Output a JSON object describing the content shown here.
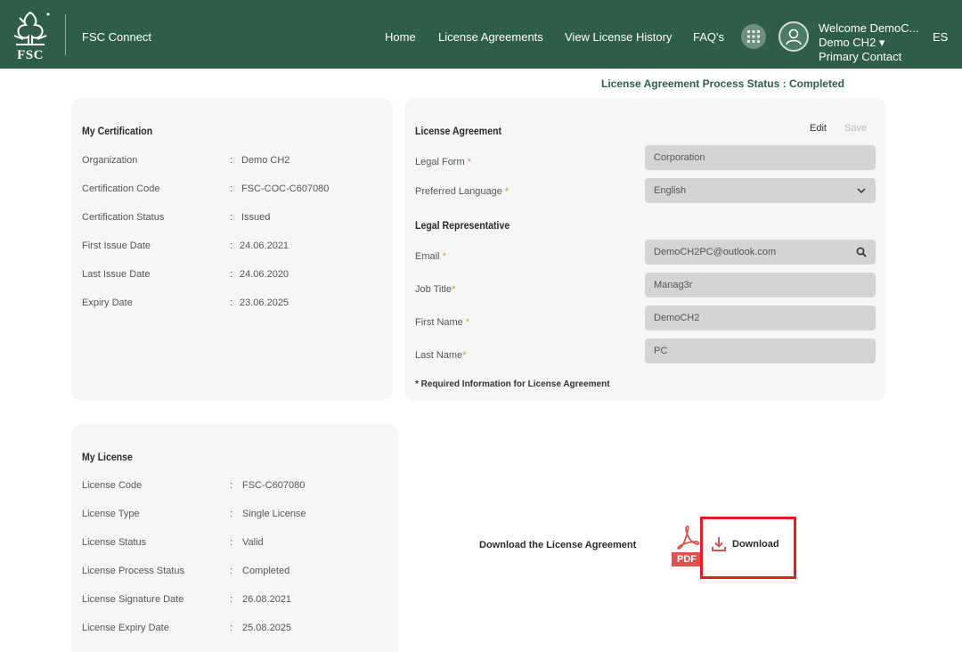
{
  "header": {
    "logo_text": "FSC",
    "app_name": "FSC Connect",
    "nav": [
      "Home",
      "License Agreements",
      "View License History",
      "FAQ's"
    ],
    "welcome_line1": "Welcome DemoC...",
    "welcome_line2": "Demo CH2 ▾",
    "welcome_line3": "Primary Contact",
    "language": "ES",
    "brand_color": "#2e5d48"
  },
  "process_status": "License Agreement Process Status : Completed",
  "certification": {
    "title": "My Certification",
    "rows": [
      {
        "label": "Organization",
        "value": "Demo CH2"
      },
      {
        "label": "Certification Code",
        "value": "FSC-COC-C607080"
      },
      {
        "label": "Certification Status",
        "value": "Issued"
      },
      {
        "label": "First Issue Date",
        "value": "24.06.2021"
      },
      {
        "label": "Last Issue Date",
        "value": "24.06.2020"
      },
      {
        "label": "Expiry Date",
        "value": "23.06.2025"
      }
    ]
  },
  "agreement": {
    "title": "License Agreement",
    "edit_label": "Edit",
    "save_label": "Save",
    "legal_form_label": "Legal Form",
    "legal_form_value": "Corporation",
    "language_label": "Preferred Language",
    "language_value": "English",
    "rep_title": "Legal Representative",
    "email_label": "Email",
    "email_value": "DemoCH2PC@outlook.com",
    "job_label": "Job Title",
    "job_value": "Manag3r",
    "first_label": "First Name",
    "first_value": "DemoCH2",
    "last_label": "Last Name",
    "last_value": "PC",
    "required_marker": "*",
    "required_note": "* Required Information for License Agreement"
  },
  "license": {
    "title": "My License",
    "rows": [
      {
        "label": "License Code",
        "value": "FSC-C607080"
      },
      {
        "label": "License Type",
        "value": "Single License"
      },
      {
        "label": "License Status",
        "value": "Valid"
      },
      {
        "label": "License Process Status",
        "value": "Completed"
      },
      {
        "label": "License Signature Date",
        "value": "26.08.2021"
      },
      {
        "label": "License Expiry Date",
        "value": "25.08.2025"
      }
    ]
  },
  "download": {
    "label": "Download the License Agreement",
    "pdf_badge": "PDF",
    "button_label": "Download",
    "highlight_color": "#e02020"
  },
  "icons": {
    "logo": "fsc-tree-logo",
    "apps": "grid-icon",
    "user": "user-avatar-icon",
    "search": "search-icon",
    "select": "chevron-down-icon",
    "pdf": "pdf-file-icon",
    "download": "download-icon"
  }
}
